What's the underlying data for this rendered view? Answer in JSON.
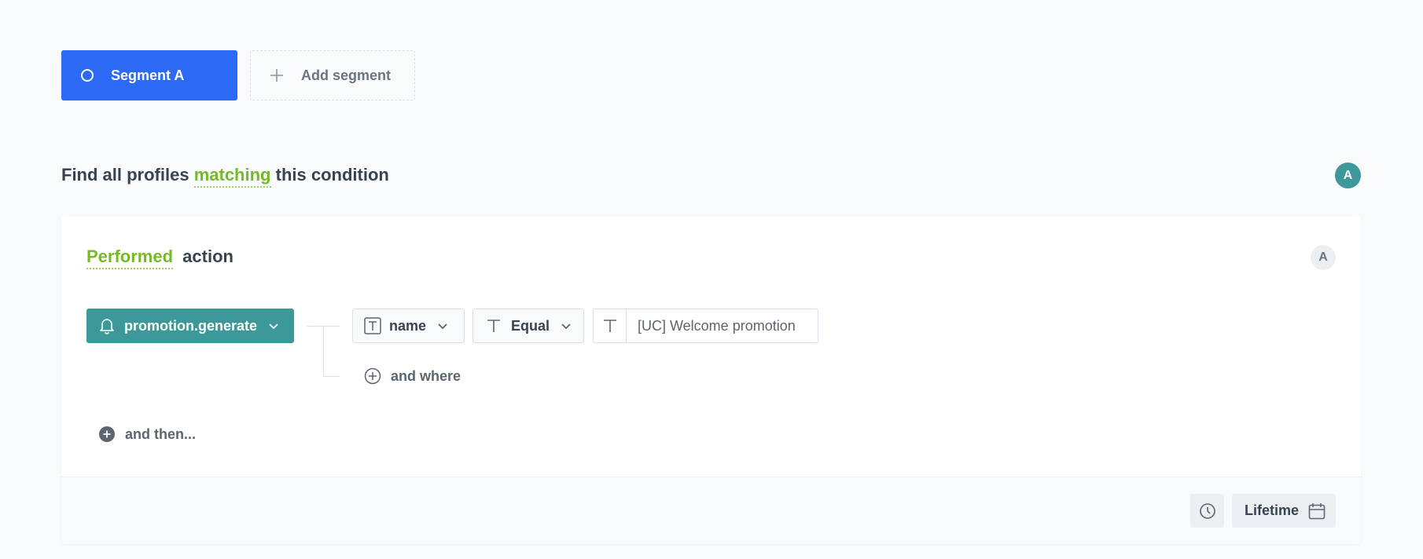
{
  "segments": {
    "active_label": "Segment A",
    "add_label": "Add segment"
  },
  "condition": {
    "prefix": "Find all profiles",
    "match_word": "matching",
    "suffix": "this condition",
    "avatar_letter": "A"
  },
  "card": {
    "performed_word": "Performed",
    "action_word": "action",
    "badge_letter": "A",
    "event_label": "promotion.generate",
    "filter": {
      "property_label": "name",
      "operator_label": "Equal",
      "value": "[UC] Welcome promotion"
    },
    "and_where_label": "and where",
    "and_then_label": "and then..."
  },
  "footer": {
    "time_label": "Lifetime"
  },
  "colors": {
    "segment_blue": "#2c6af6",
    "teal": "#3c9899",
    "green": "#76ba2a"
  },
  "icons": [
    "circle-icon",
    "plus-icon",
    "bell-icon",
    "chevron-down-icon",
    "text-type-icon",
    "plus-circle-icon",
    "clock-icon",
    "calendar-icon"
  ]
}
